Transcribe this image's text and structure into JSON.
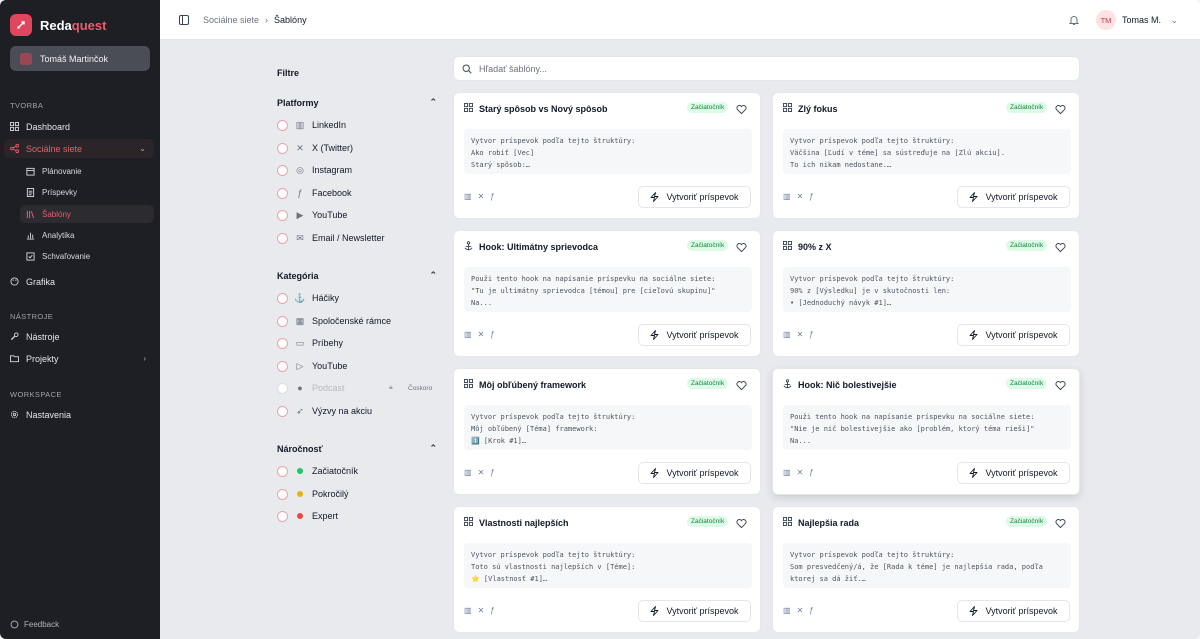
{
  "brand": {
    "name_a": "Reda",
    "name_b": "quest"
  },
  "sidebar": {
    "user_card": "Tomáš Martinčok",
    "sections": {
      "tvorba": "TVORBA",
      "nastroje": "NÁSTROJE",
      "workspace": "WORKSPACE"
    },
    "items": {
      "dashboard": "Dashboard",
      "socialne": "Sociálne siete",
      "planovanie": "Plánovanie",
      "prispevky": "Príspevky",
      "sablony": "Šablóny",
      "analytika": "Analytika",
      "schvalovanie": "Schvaľovanie",
      "grafika": "Grafika",
      "nastroje": "Nástroje",
      "projekty": "Projekty",
      "nastavenia": "Nastavenia"
    },
    "feedback": "Feedback"
  },
  "topbar": {
    "crumb_parent": "Sociálne siete",
    "crumb_current": "Šablóny",
    "user_initials": "TM",
    "user_name": "Tomas M."
  },
  "filters": {
    "title": "Filtre",
    "platformy": {
      "title": "Platformy",
      "options": [
        "LinkedIn",
        "X (Twitter)",
        "Instagram",
        "Facebook",
        "YouTube",
        "Email / Newsletter"
      ]
    },
    "kategoria": {
      "title": "Kategória",
      "options": [
        "Háčiky",
        "Spoločenské rámce",
        "Príbehy",
        "YouTube",
        "Podcast",
        "Výzvy na akciu"
      ],
      "soon": "Čoskoro"
    },
    "narocnost": {
      "title": "Náročnosť",
      "options": [
        "Začiatočník",
        "Pokročilý",
        "Expert"
      ],
      "colors": [
        "#22c55e",
        "#eab308",
        "#ef4444"
      ]
    }
  },
  "search": {
    "placeholder": "Hľadať šablóny..."
  },
  "cards": [
    {
      "title": "Starý spôsob vs Nový spôsob",
      "badge": "Začiatočník",
      "icon": "grid-icon",
      "body": "Vytvor príspevok podľa tejto štruktúry:\nAko robiť [Vec]\nStarý spôsob:…",
      "button": "Vytvoriť príspevok"
    },
    {
      "title": "Zlý fokus",
      "badge": "Začiatočník",
      "icon": "grid-icon",
      "body": "Vytvor príspevok podľa tejto štruktúry:\nVäčšina [Ľudí v téme] sa sústreďuje na [Zlú akciu].\nTo ich nikam nedostane.…",
      "button": "Vytvoriť príspevok"
    },
    {
      "title": "Hook: Ultimátny sprievodca",
      "badge": "Začiatočník",
      "icon": "anchor-icon",
      "body": "Použi tento hook na napísanie príspevku na sociálne siete:\n\"Tu je ultimátny sprievodca [témou] pre [cieľovú skupinu]\"\nNa...",
      "button": "Vytvoriť príspevok"
    },
    {
      "title": "90% z X",
      "badge": "Začiatočník",
      "icon": "grid-icon",
      "body": "Vytvor príspevok podľa tejto štruktúry:\n90% z [Výsledku] je v skutočnosti len:\n• [Jednoduchý návyk #1]…",
      "button": "Vytvoriť príspevok"
    },
    {
      "title": "Môj obľúbený framework",
      "badge": "Začiatočník",
      "icon": "grid-icon",
      "body": "Vytvor príspevok podľa tejto štruktúry:\nMôj obľúbený [Téma] framework:\n1️⃣ [Krok #1]…",
      "button": "Vytvoriť príspevok"
    },
    {
      "title": "Hook: Nič bolestivejšie",
      "badge": "Začiatočník",
      "icon": "anchor-icon",
      "body": "Použi tento hook na napísanie príspevku na sociálne siete:\n\"Nie je nič bolestivejšie ako [problém, ktorý téma rieši]\"\nNa...",
      "button": "Vytvoriť príspevok"
    },
    {
      "title": "Vlastnosti najlepších",
      "badge": "Začiatočník",
      "icon": "grid-icon",
      "body": "Vytvor príspevok podľa tejto štruktúry:\nToto sú vlastnosti najlepších v [Téme]:\n⭐ [Vlastnosť #1]…",
      "button": "Vytvoriť príspevok"
    },
    {
      "title": "Najlepšia rada",
      "badge": "Začiatočník",
      "icon": "grid-icon",
      "body": "Vytvor príspevok podľa tejto štruktúry:\nSom presvedčený/á, že [Rada k téme] je najlepšia rada, podľa\nktorej sa dá žiť.…",
      "button": "Vytvoriť príspevok"
    }
  ],
  "colors": {
    "accent": "#e0475e",
    "sidebar_bg": "#1d1f24",
    "badge_bg": "#dcfce7",
    "badge_text": "#15803d"
  }
}
